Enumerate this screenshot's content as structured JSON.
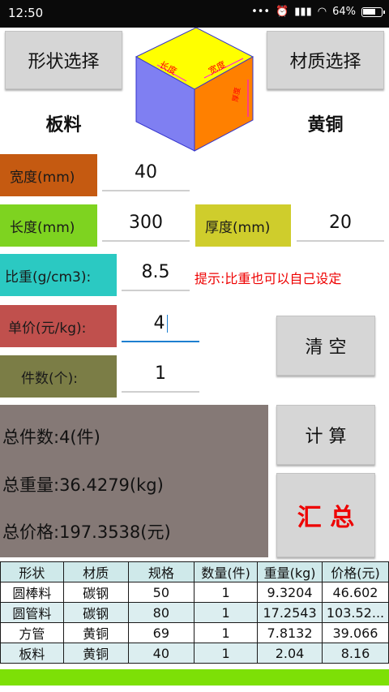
{
  "status_bar": {
    "time": "12:50",
    "battery": "64%"
  },
  "buttons": {
    "shape_select": "形状选择",
    "material_select": "材质选择",
    "clear": "清 空",
    "calculate": "计 算",
    "summary": "汇 总"
  },
  "shape_name": "板料",
  "material_name": "黄铜",
  "diagram_labels": {
    "length": "长度",
    "width": "宽度",
    "thickness": "厚度"
  },
  "fields": {
    "width": {
      "label": "宽度(mm)",
      "value": "40",
      "color": "#c55a11"
    },
    "length": {
      "label": "长度(mm)",
      "value": "300",
      "color": "#7ed320"
    },
    "thickness": {
      "label": "厚度(mm)",
      "value": "20",
      "color": "#cfcd2c"
    },
    "density": {
      "label": "比重(g/cm3):",
      "value": "8.5",
      "color": "#2bc9c2"
    },
    "unit_price": {
      "label": "单价(元/kg):",
      "value": "4",
      "color": "#c0504d"
    },
    "count": {
      "label": "件数(个):",
      "value": "1",
      "color": "#7b7d46"
    }
  },
  "hint": "提示:比重也可以自己设定",
  "summary": {
    "total_count": "总件数:4(件)",
    "total_weight": "总重量:36.4279(kg)",
    "total_price": "总价格:197.3538(元)"
  },
  "table": {
    "headers": [
      "形状",
      "材质",
      "规格",
      "数量(件)",
      "重量(kg)",
      "价格(元)"
    ],
    "rows": [
      [
        "圆棒料",
        "碳钢",
        "50",
        "1",
        "9.3204",
        "46.602"
      ],
      [
        "圆管料",
        "碳钢",
        "80",
        "1",
        "17.2543",
        "103.52..."
      ],
      [
        "方管",
        "黄铜",
        "69",
        "1",
        "7.8132",
        "39.066"
      ],
      [
        "板料",
        "黄铜",
        "40",
        "1",
        "2.04",
        "8.16"
      ]
    ]
  }
}
